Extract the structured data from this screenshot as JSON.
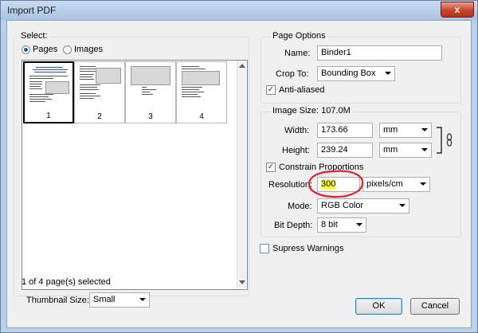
{
  "window": {
    "title": "Import PDF",
    "close_glyph": "x"
  },
  "select_group": {
    "label": "Select:",
    "pages_label": "Pages",
    "images_label": "Images",
    "thumbnails": [
      {
        "num": "1"
      },
      {
        "num": "2"
      },
      {
        "num": "3"
      },
      {
        "num": "4"
      }
    ],
    "selection_status": "1 of 4 page(s) selected",
    "thumbnail_size_label": "Thumbnail Size:",
    "thumbnail_size_value": "Small"
  },
  "page_options": {
    "label": "Page Options",
    "name_label": "Name:",
    "name_value": "Binder1",
    "crop_label": "Crop To:",
    "crop_value": "Bounding Box",
    "anti_aliased_label": "Anti-aliased",
    "anti_aliased_checked": true
  },
  "image_size": {
    "label": "Image Size: 107.0M",
    "width_label": "Width:",
    "width_value": "173.66",
    "width_unit": "mm",
    "height_label": "Height:",
    "height_value": "239.24",
    "height_unit": "mm",
    "constrain_label": "Constrain Proportions",
    "constrain_checked": true,
    "resolution_label": "Resolution:",
    "resolution_value": "300",
    "resolution_unit": "pixels/cm",
    "mode_label": "Mode:",
    "mode_value": "RGB Color",
    "bit_depth_label": "Bit Depth:",
    "bit_depth_value": "8 bit"
  },
  "suppress_warnings_label": "Supress Warnings",
  "buttons": {
    "ok": "OK",
    "cancel": "Cancel"
  },
  "colors": {
    "highlight": "#ffff33",
    "annotation_circle": "#e0202a",
    "title_bar": "#b9d1ea"
  }
}
